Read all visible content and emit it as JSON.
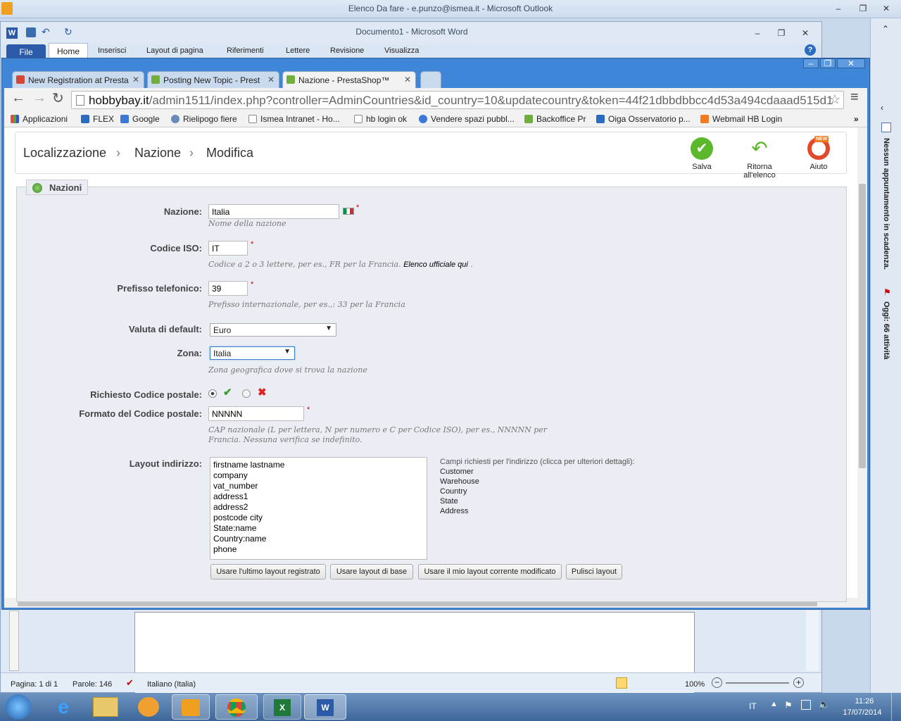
{
  "outlook": {
    "title": "Elenco Da fare - e.punzo@ismea.it - Microsoft Outlook",
    "side_top": "Nessun appuntamento in scadenza.",
    "side_bottom": "Oggi: 66 attività"
  },
  "word": {
    "title": "Documento1 - Microsoft Word",
    "tabs": [
      "File",
      "Home",
      "Inserisci",
      "Layout di pagina",
      "Riferimenti",
      "Lettere",
      "Revisione",
      "Visualizza"
    ],
    "status": {
      "page": "Pagina: 1 di 1",
      "words": "Parole: 146",
      "lang": "Italiano (Italia)",
      "zoom": "100%"
    }
  },
  "chrome": {
    "tabs": [
      {
        "label": "New Registration at Presta"
      },
      {
        "label": "Posting New Topic - Prest"
      },
      {
        "label": "Nazione - PrestaShop™"
      }
    ],
    "url_host": "hobbybay.it",
    "url_path": "/admin1511/index.php?controller=AdminCountries&id_country=10&updatecountry&token=44f21dbbdbbcc4d53a494cdaaad515d1",
    "bookmarks": [
      "Applicazioni",
      "FLEX",
      "Google",
      "Rielipogo fiere",
      "Ismea Intranet - Ho...",
      "hb login ok",
      "Vendere spazi pubbl...",
      "Backoffice Pr",
      "Oiga Osservatorio p...",
      "Webmail HB Login"
    ]
  },
  "ps": {
    "breadcrumb": [
      "Localizzazione",
      "Nazione",
      "Modifica"
    ],
    "toolbar": {
      "save": "Salva",
      "back": "Ritorna all'elenco",
      "help": "Aiuto",
      "new_badge": "NEW"
    },
    "legend": "Nazioni",
    "fields": {
      "name": {
        "label": "Nazione:",
        "value": "Italia",
        "hint": "Nome della nazione"
      },
      "iso": {
        "label": "Codice ISO:",
        "value": "IT",
        "hint": "Codice a 2 o 3 lettere, per es., FR per la Francia.",
        "link": "Elenco ufficiale qui",
        "dot": "."
      },
      "phone": {
        "label": "Prefisso telefonico:",
        "value": "39",
        "hint": "Prefisso internazionale, per es.,: 33 per la Francia"
      },
      "currency": {
        "label": "Valuta di default:",
        "value": "Euro"
      },
      "zone": {
        "label": "Zona:",
        "value": "Italia",
        "hint": "Zona geografica dove si trova la nazione"
      },
      "zip_required": {
        "label": "Richiesto Codice postale:",
        "selected": "yes"
      },
      "zip_format": {
        "label": "Formato del Codice postale:",
        "value": "NNNNN",
        "hint1": "CAP nazionale (L per lettera, N per numero e C per Codice ISO), per es., NNNNN per",
        "hint2": "Francia. Nessuna verifica se indefinito."
      },
      "layout": {
        "label": "Layout indirizzo:",
        "lines": [
          "firstname lastname",
          "company",
          "vat_number",
          "address1",
          "address2",
          "postcode city",
          "State:name",
          "Country:name",
          "phone"
        ],
        "side_title": "Campi richiesti per l'indirizzo (clicca per ulteriori dettagli):",
        "side_items": [
          "Customer",
          "Warehouse",
          "Country",
          "State",
          "Address"
        ]
      }
    },
    "buttons": [
      "Usare l'ultimo layout registrato",
      "Usare layout di base",
      "Usare il mio layout corrente modificato",
      "Pulisci layout"
    ]
  },
  "taskbar": {
    "lang": "IT",
    "time": "11:26",
    "date": "17/07/2014"
  }
}
